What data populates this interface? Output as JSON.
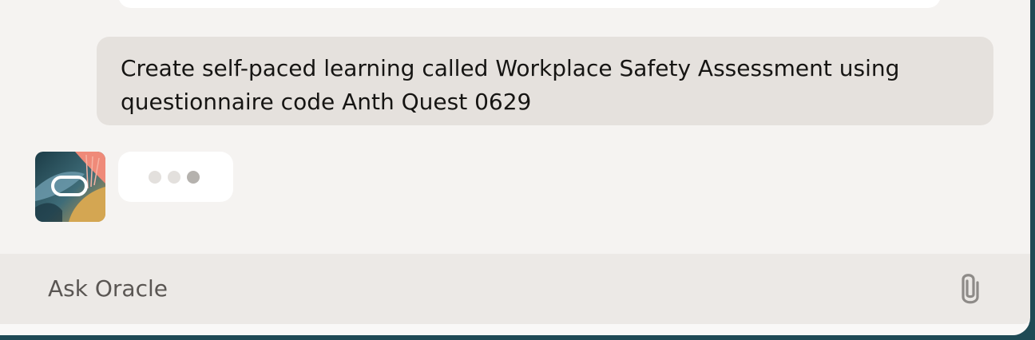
{
  "chat": {
    "user_message": "Create self-paced learning called Workplace Safety Assessment using questionnaire code Anth Quest 0629"
  },
  "composer": {
    "placeholder": "Ask Oracle"
  },
  "icons": {
    "assistant_avatar": "oracle-avatar-icon",
    "typing_indicator": "typing-dots-icon",
    "attach": "paperclip-icon"
  },
  "colors": {
    "user_bubble": "#e5e1dd",
    "panel_bg": "#f5f3f1",
    "frame_bg": "#1f4a55"
  }
}
